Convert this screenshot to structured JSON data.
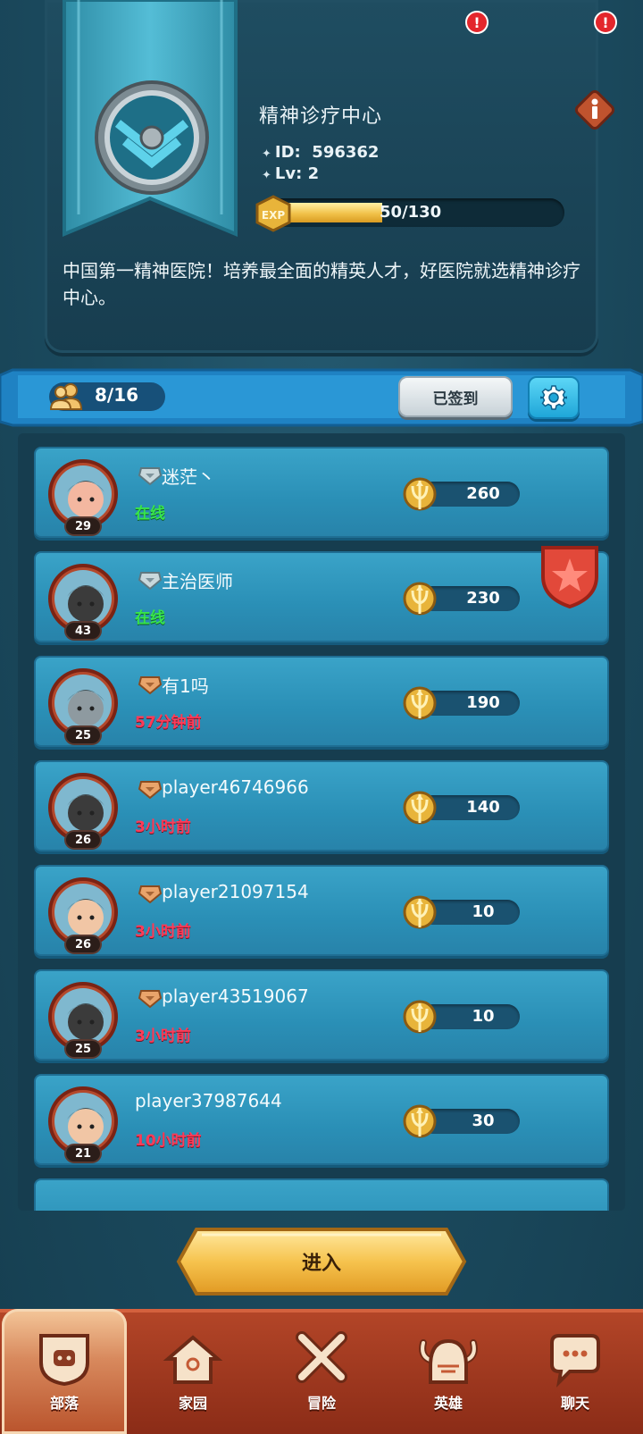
{
  "tribe": {
    "name": "精神诊疗中心",
    "id_label": "ID:",
    "id_value": "596362",
    "lv_label": "Lv:",
    "lv_value": "2",
    "exp_label": "EXP",
    "exp_text": "50/130",
    "exp_progress": 0.385,
    "description": "中国第一精神医院！培养最全面的精英人才，好医院就选精神诊疗中心。",
    "info_icon": "info-icon"
  },
  "members_bar": {
    "count": "8/16",
    "signed_label": "已签到",
    "settings_icon": "gear-icon"
  },
  "members": [
    {
      "name": "迷茫丶",
      "level": "29",
      "status": "在线",
      "online": true,
      "points": "260",
      "rank": "silver",
      "leader": false
    },
    {
      "name": "主治医师",
      "level": "43",
      "status": "在线",
      "online": true,
      "points": "230",
      "rank": "silver",
      "leader": true
    },
    {
      "name": "有1吗",
      "level": "25",
      "status": "57分钟前",
      "online": false,
      "points": "190",
      "rank": "bronze",
      "leader": false
    },
    {
      "name": "player46746966",
      "level": "26",
      "status": "3小时前",
      "online": false,
      "points": "140",
      "rank": "bronze",
      "leader": false
    },
    {
      "name": "player21097154",
      "level": "26",
      "status": "3小时前",
      "online": false,
      "points": "10",
      "rank": "bronze",
      "leader": false
    },
    {
      "name": "player43519067",
      "level": "25",
      "status": "3小时前",
      "online": false,
      "points": "10",
      "rank": "bronze",
      "leader": false
    },
    {
      "name": "player37987644",
      "level": "21",
      "status": "10小时前",
      "online": false,
      "points": "30",
      "rank": "none",
      "leader": false
    }
  ],
  "enter_button": "进入",
  "nav": {
    "tribe": "部落",
    "home": "家园",
    "adventure": "冒险",
    "heroes": "英雄",
    "chat": "聊天",
    "alert": "!"
  },
  "colors": {
    "online": "#38e54b",
    "offline": "#ff3b58",
    "row": "#2a8fb6",
    "nav": "#a33d21"
  }
}
